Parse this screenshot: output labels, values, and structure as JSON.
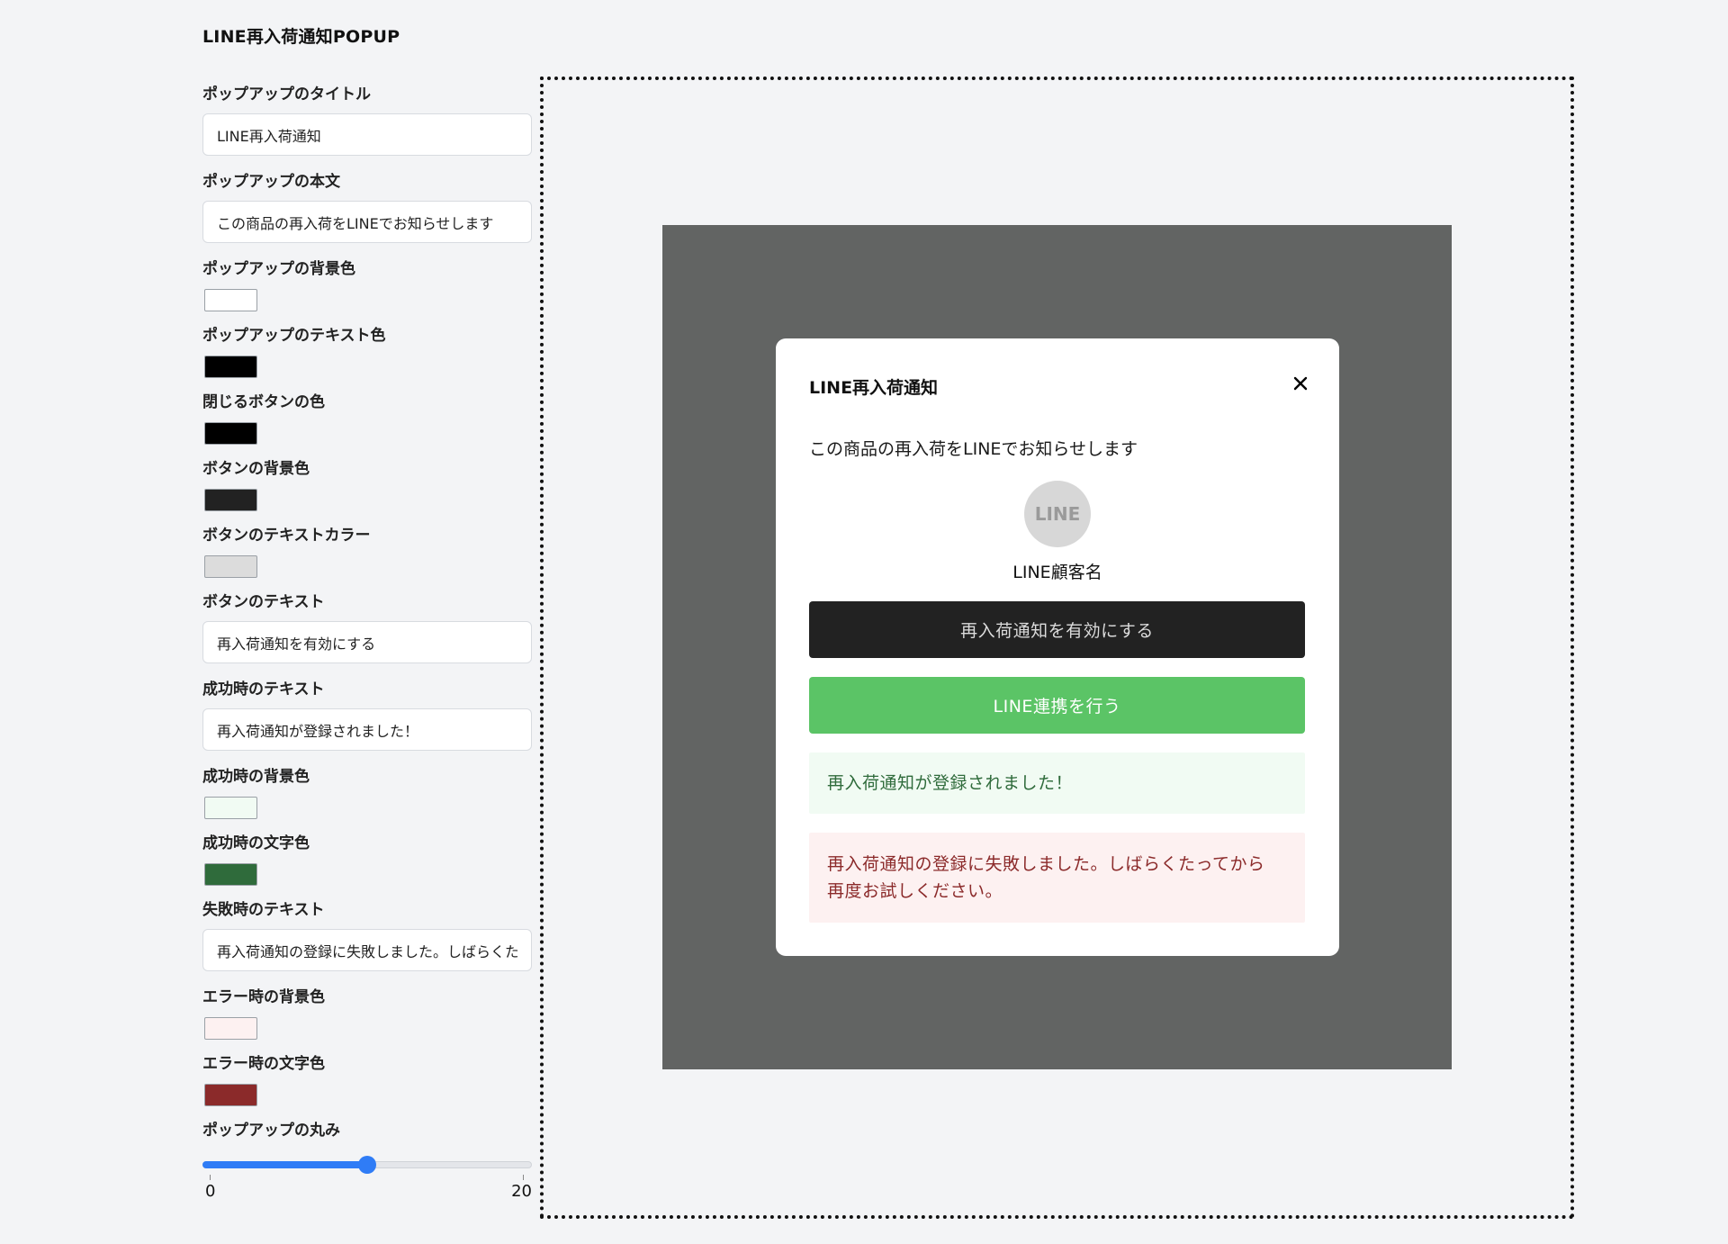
{
  "header": {
    "title": "LINE再入荷通知POPUP"
  },
  "settings": {
    "popup_title": {
      "label": "ポップアップのタイトル",
      "value": "LINE再入荷通知"
    },
    "popup_body": {
      "label": "ポップアップの本文",
      "value": "この商品の再入荷をLINEでお知らせします"
    },
    "popup_bg_color": {
      "label": "ポップアップの背景色",
      "color": "#ffffff"
    },
    "popup_text_color": {
      "label": "ポップアップのテキスト色",
      "color": "#000000"
    },
    "close_button_color": {
      "label": "閉じるボタンの色",
      "color": "#000000"
    },
    "button_bg_color": {
      "label": "ボタンの背景色",
      "color": "#222222"
    },
    "button_text_color": {
      "label": "ボタンのテキストカラー",
      "color": "#dcdcdc"
    },
    "button_text": {
      "label": "ボタンのテキスト",
      "value": "再入荷通知を有効にする"
    },
    "success_text": {
      "label": "成功時のテキスト",
      "value": "再入荷通知が登録されました！"
    },
    "success_bg_color": {
      "label": "成功時の背景色",
      "color": "#f1fbf3"
    },
    "success_text_color": {
      "label": "成功時の文字色",
      "color": "#2f6b3b"
    },
    "error_text": {
      "label": "失敗時のテキスト",
      "value": "再入荷通知の登録に失敗しました。しばらくたってから再度お試しください。"
    },
    "error_bg_color": {
      "label": "エラー時の背景色",
      "color": "#fdf1f1"
    },
    "error_text_color": {
      "label": "エラー時の文字色",
      "color": "#8b2a2a"
    },
    "popup_radius": {
      "label": "ポップアップの丸み",
      "min": "0",
      "max": "20",
      "value": 10
    }
  },
  "preview": {
    "overlay_color": "#626463",
    "popup": {
      "title": "LINE再入荷通知",
      "close_icon": "close-icon",
      "body": "この商品の再入荷をLINEでお知らせします",
      "avatar_text": "LINE",
      "customer_name": "LINE顧客名",
      "enable_button": "再入荷通知を有効にする",
      "line_button": "LINE連携を行う",
      "line_button_color": "#5bc466",
      "success_message": "再入荷通知が登録されました！",
      "error_message_line1": "再入荷通知の登録に失敗しました。しばらくたってから",
      "error_message_line2": "再度お試しください。"
    }
  }
}
